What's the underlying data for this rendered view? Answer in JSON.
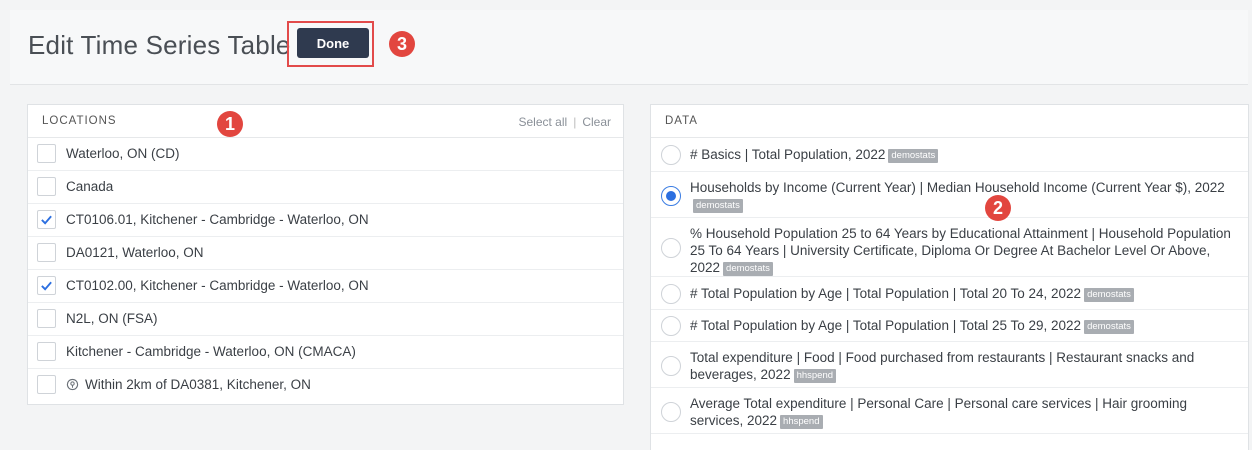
{
  "header": {
    "title": "Edit Time Series Table",
    "done_label": "Done"
  },
  "callouts": [
    "1",
    "2",
    "3"
  ],
  "locations_panel": {
    "title": "LOCATIONS",
    "select_all": "Select all",
    "separator": "|",
    "clear": "Clear",
    "items": [
      {
        "label": "Waterloo, ON (CD)",
        "checked": false
      },
      {
        "label": "Canada",
        "checked": false
      },
      {
        "label": "CT0106.01, Kitchener - Cambridge - Waterloo, ON",
        "checked": true
      },
      {
        "label": "DA0121, Waterloo, ON",
        "checked": false
      },
      {
        "label": "CT0102.00, Kitchener - Cambridge - Waterloo, ON",
        "checked": true
      },
      {
        "label": "N2L, ON (FSA)",
        "checked": false
      },
      {
        "label": "Kitchener - Cambridge - Waterloo, ON (CMACA)",
        "checked": false
      },
      {
        "label": "Within 2km of DA0381, Kitchener, ON",
        "checked": false,
        "icon": "location-pin-icon"
      }
    ]
  },
  "data_panel": {
    "title": "DATA",
    "items": [
      {
        "text": "# Basics | Total Population, 2022",
        "badge": "demostats",
        "selected": false
      },
      {
        "text": "Households by Income (Current Year) | Median Household Income (Current Year $), 2022",
        "badge": "demostats",
        "selected": true
      },
      {
        "text": "% Household Population 25 to 64 Years by Educational Attainment | Household Population 25 To 64 Years | University Certificate, Diploma Or Degree At Bachelor Level Or Above, 2022",
        "badge": "demostats",
        "selected": false
      },
      {
        "text": "# Total Population by Age | Total Population | Total 20 To 24, 2022",
        "badge": "demostats",
        "selected": false
      },
      {
        "text": "# Total Population by Age | Total Population | Total 25 To 29, 2022",
        "badge": "demostats",
        "selected": false
      },
      {
        "text": "Total expenditure | Food | Food purchased from restaurants | Restaurant snacks and beverages, 2022",
        "badge": "hhspend",
        "selected": false
      },
      {
        "text": "Average Total expenditure | Personal Care | Personal care services | Hair grooming services, 2022",
        "badge": "hhspend",
        "selected": false
      }
    ]
  },
  "colors": {
    "done_button": "#2f3a4f",
    "callout": "#e2463f",
    "radio_selected": "#2c6fe0",
    "checkbox_check": "#2c6fe0"
  }
}
